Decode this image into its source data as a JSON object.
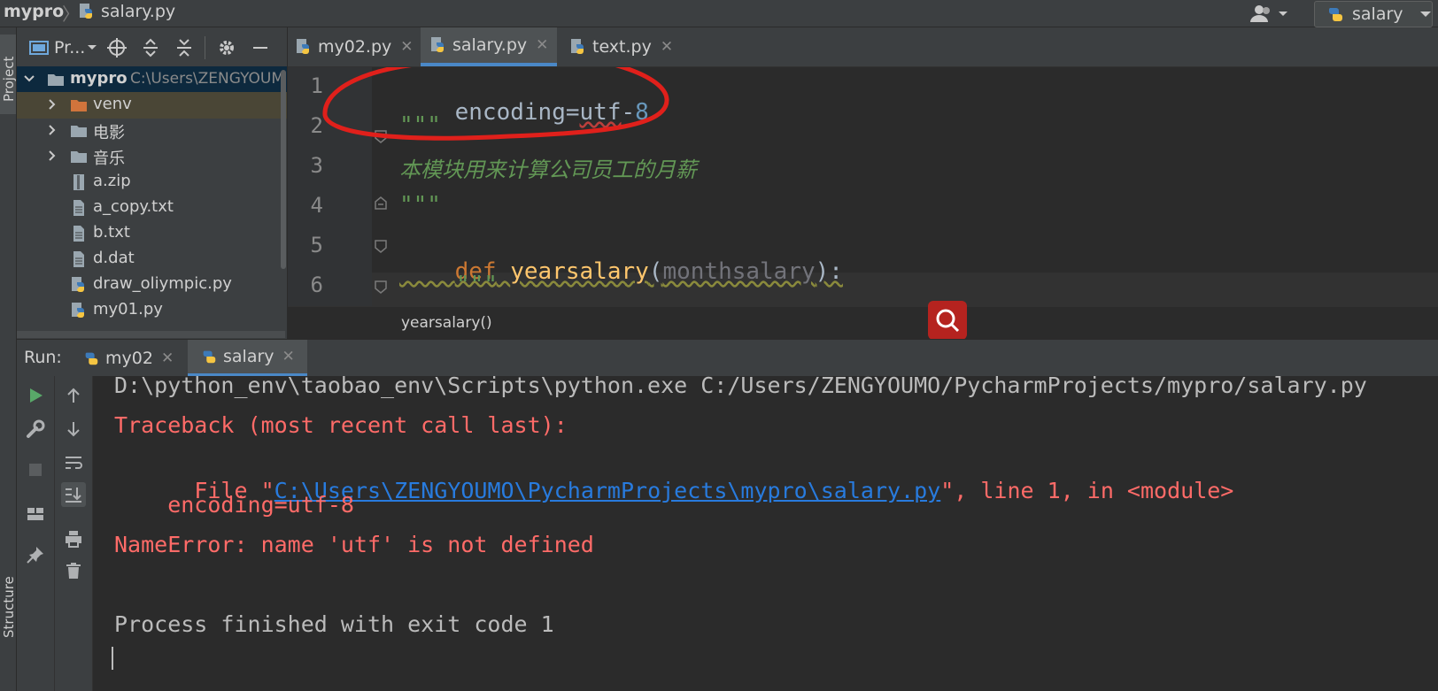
{
  "navbar": {
    "project": "mypro",
    "file": "salary.py",
    "run_config": "salary"
  },
  "left_strip": {
    "project_tab": "Project",
    "structure_tab": "Structure"
  },
  "project_panel": {
    "title": "Pr...",
    "tree": [
      {
        "label": "mypro",
        "path": "C:\\Users\\ZENGYOUM",
        "kind": "root-folder"
      },
      {
        "label": "venv",
        "kind": "venv-folder"
      },
      {
        "label": "电影",
        "kind": "folder"
      },
      {
        "label": "音乐",
        "kind": "folder"
      },
      {
        "label": "a.zip",
        "kind": "zip"
      },
      {
        "label": "a_copy.txt",
        "kind": "text"
      },
      {
        "label": "b.txt",
        "kind": "text"
      },
      {
        "label": "d.dat",
        "kind": "text"
      },
      {
        "label": "draw_oliympic.py",
        "kind": "python"
      },
      {
        "label": "my01.py",
        "kind": "python"
      }
    ]
  },
  "editor_tabs": [
    {
      "label": "my02.py",
      "active": false
    },
    {
      "label": "salary.py",
      "active": true
    },
    {
      "label": "text.py",
      "active": false
    }
  ],
  "editor": {
    "line_numbers": [
      "1",
      "2",
      "3",
      "4",
      "5",
      "6"
    ],
    "line1": {
      "ident": "encoding",
      "eq": "=",
      "word": "utf",
      "minus": "-",
      "num": "8"
    },
    "line2": "\"\"\"",
    "line3": "本模块用来计算公司员工的月薪",
    "line4": "\"\"\"",
    "line5": {
      "kw": "def",
      "fn": "yearsalary",
      "open": "(",
      "param": "monthsalary",
      "close": "):"
    },
    "line6": "\"\"\"",
    "breadcrumb": "yearsalary()"
  },
  "run_panel": {
    "label": "Run:",
    "tabs": [
      {
        "label": "my02",
        "active": false
      },
      {
        "label": "salary",
        "active": true
      }
    ],
    "console": {
      "cmd": "D:\\python_env\\taobao_env\\Scripts\\python.exe C:/Users/ZENGYOUMO/PycharmProjects/mypro/salary.py",
      "traceback": "Traceback (most recent call last):",
      "file_prefix": "  File \"",
      "file_link": "C:\\Users\\ZENGYOUMO\\PycharmProjects\\mypro\\salary.py",
      "file_suffix": "\", line 1, in <module>",
      "code_line": "    encoding=utf-8",
      "error": "NameError: name 'utf' is not defined",
      "exit": "Process finished with exit code 1"
    }
  },
  "colors": {
    "bg": "#2b2b2b",
    "panel": "#3c3f41",
    "keyword": "#cc7832",
    "function": "#ffc66d",
    "string_doc": "#629755",
    "number": "#6897bb",
    "error_text": "#ff6b68",
    "link": "#287bde",
    "annotation": "#e0201b"
  }
}
